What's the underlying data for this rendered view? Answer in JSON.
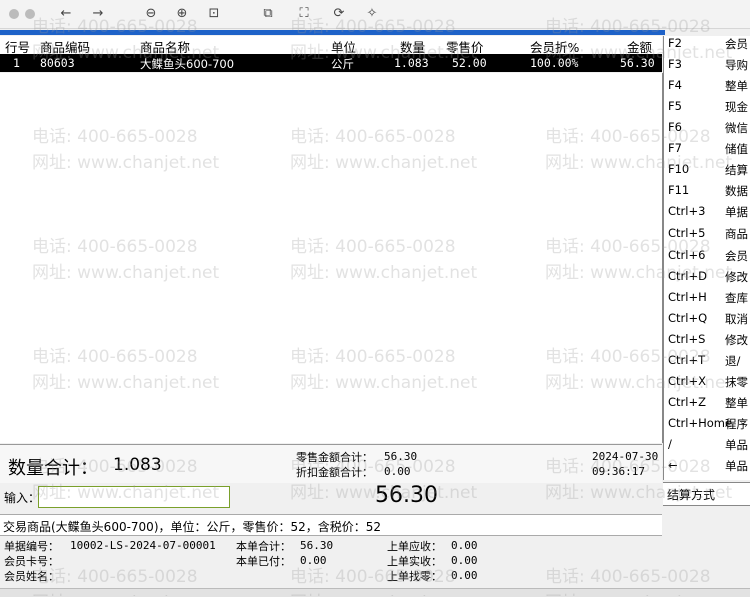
{
  "toolbar": {
    "icons": [
      "close-icon",
      "close-icon",
      "back-icon",
      "forward-icon",
      "zoom-out-icon",
      "zoom-in-icon",
      "fit-icon",
      "copy-icon",
      "crop-icon",
      "rotate-icon",
      "magic-icon"
    ],
    "glyphs": [
      "←",
      "→",
      "⊖",
      "⊕",
      "⊡",
      "⧉",
      "⛶",
      "⟳",
      "✧"
    ]
  },
  "table": {
    "headers": {
      "line": "行号",
      "code": "商品编码",
      "name": "商品名称",
      "unit": "单位",
      "qty": "数量",
      "price": "零售价",
      "disc": "会员折%",
      "amount": "金额"
    },
    "rows": [
      {
        "line": "1",
        "code": "80603",
        "name": "大鲽鱼头600-700",
        "unit": "公斤",
        "qty": "1.083",
        "price": "52.00",
        "disc": "100.00%",
        "amount": "56.30"
      }
    ]
  },
  "shortcuts": [
    {
      "key": "F2",
      "label": "会员"
    },
    {
      "key": "F3",
      "label": "导购"
    },
    {
      "key": "F4",
      "label": "整单"
    },
    {
      "key": "F5",
      "label": "现金"
    },
    {
      "key": "F6",
      "label": "微信"
    },
    {
      "key": "F7",
      "label": "储值"
    },
    {
      "key": "F10",
      "label": "结算"
    },
    {
      "key": "F11",
      "label": "数据"
    },
    {
      "key": "Ctrl+3",
      "label": "单据"
    },
    {
      "key": "Ctrl+5",
      "label": "商品"
    },
    {
      "key": "Ctrl+6",
      "label": "会员"
    },
    {
      "key": "Ctrl+D",
      "label": "修改"
    },
    {
      "key": "Ctrl+H",
      "label": "查库"
    },
    {
      "key": "Ctrl+Q",
      "label": "取消"
    },
    {
      "key": "Ctrl+S",
      "label": "修改"
    },
    {
      "key": "Ctrl+T",
      "label": "退/"
    },
    {
      "key": "Ctrl+X",
      "label": "抹零"
    },
    {
      "key": "Ctrl+Z",
      "label": "整单"
    },
    {
      "key": "Ctrl+Home",
      "label": "程序"
    },
    {
      "key": "/",
      "label": "单品"
    },
    {
      "key": "←",
      "label": "单品"
    }
  ],
  "settle_label": "结算方式",
  "totals": {
    "qty_label": "数量合计：",
    "qty_value": "1.083",
    "retail_label": "零售金额合计：",
    "retail_value": "56.30",
    "discount_label": "折扣金额合计：",
    "discount_value": "0.00",
    "date": "2024-07-30",
    "time": "09:36:17"
  },
  "input": {
    "label": "输入：",
    "amount": "56.30"
  },
  "transaction_text": "交易商品(大鲽鱼头600-700)，单位：公斤，零售价：52，含税价：52",
  "footer": {
    "receipt_label": "单据编号：",
    "receipt_value": "10002-LS-2024-07-00001",
    "card_label": "会员卡号：",
    "member_label": "会员姓名：",
    "total_label": "本单合计：",
    "total_value": "56.30",
    "paid_label": "本单已付：",
    "paid_value": "0.00",
    "prev_due_label": "上单应收：",
    "prev_due_value": "0.00",
    "prev_recv_label": "上单实收：",
    "prev_recv_value": "0.00",
    "prev_change_label": "上单找零：",
    "prev_change_value": "0.00"
  },
  "watermark": {
    "phone": "电话: 400-665-0028",
    "site": "网址: www.chanjet.net"
  }
}
